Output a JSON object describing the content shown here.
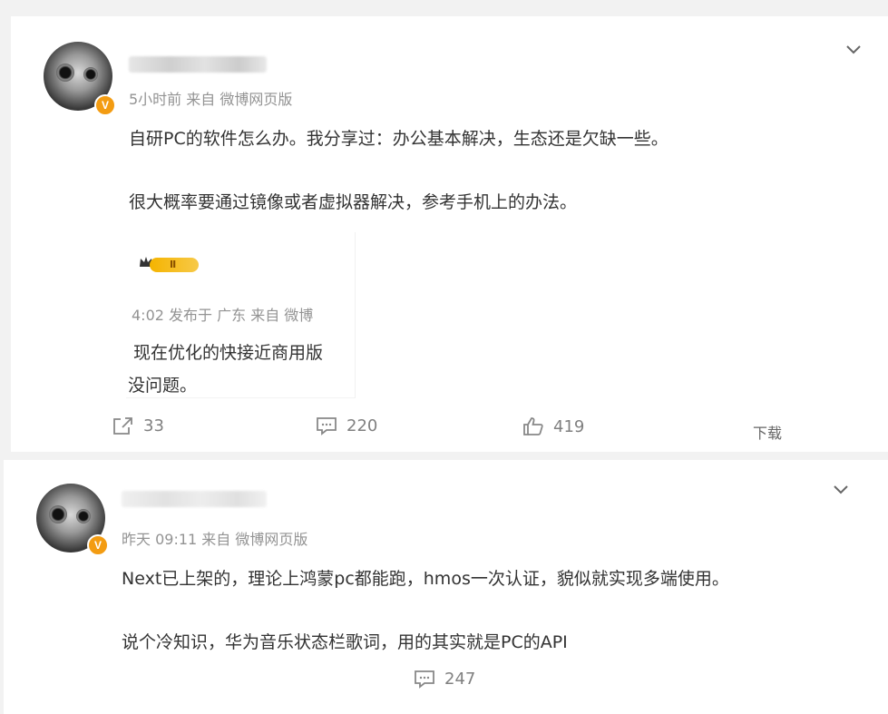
{
  "post1": {
    "meta": "5小时前 来自 微博网页版",
    "line1": "自研PC的软件怎么办。我分享过：办公基本解决，生态还是欠缺一些。",
    "line2": "很大概率要通过镜像或者虚拟器解决，参考手机上的办法。",
    "repost": {
      "badge": "Ⅱ",
      "meta": "4:02 发布于 广东 来自 微博",
      "line1": "现在优化的快接近商用版",
      "line2": "没问题。"
    },
    "actions": {
      "share_count": "33",
      "comment_count": "220",
      "like_count": "419",
      "download_label": "下载"
    }
  },
  "post2": {
    "meta": "昨天 09:11 来自 微博网页版",
    "line1": "Next已上架的，理论上鸿蒙pc都能跑，hmos一次认证，貌似就实现多端使用。",
    "line2": "说个冷知识，华为音乐状态栏歌词，用的其实就是PC的API",
    "actions": {
      "comment_count": "247"
    }
  },
  "colors": {
    "accent_badge": "#f39c12",
    "meta_text": "#939393",
    "body_text": "#333333"
  }
}
